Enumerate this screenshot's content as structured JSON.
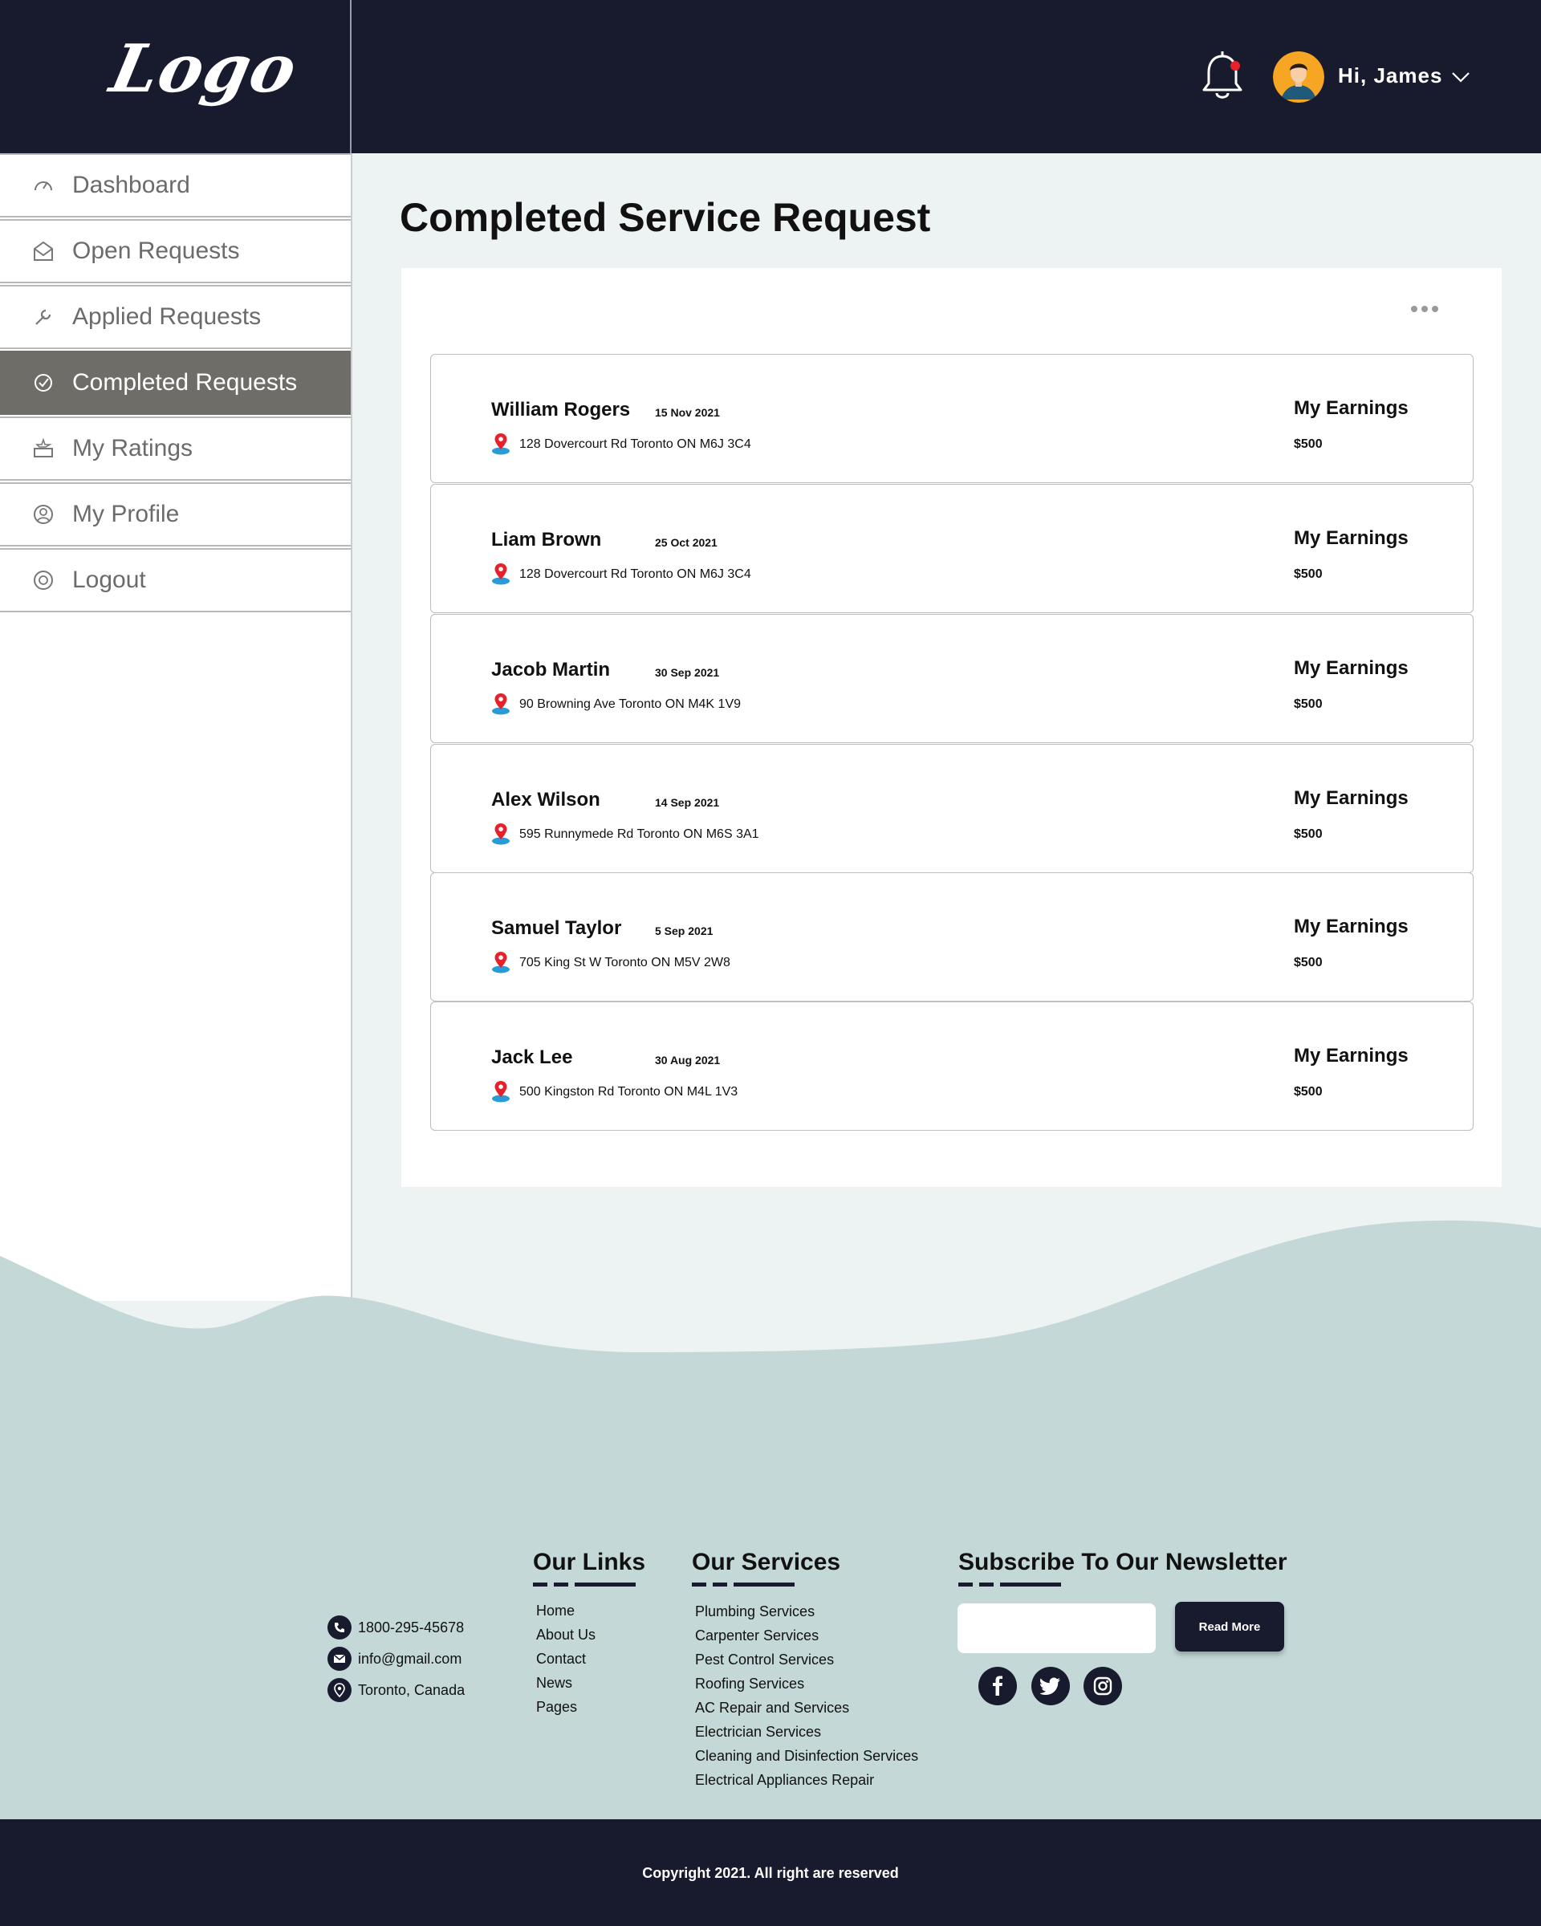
{
  "header": {
    "logo": "Logo",
    "greeting": "Hi, James",
    "notification_dot_color": "#e8202a"
  },
  "sidebar": {
    "items": [
      {
        "label": "Dashboard",
        "icon": "speedometer-icon"
      },
      {
        "label": "Open Requests",
        "icon": "open-envelope-icon"
      },
      {
        "label": "Applied Requests",
        "icon": "wrench-icon"
      },
      {
        "label": "Completed Requests",
        "icon": "check-circle-icon",
        "active": true
      },
      {
        "label": "My Ratings",
        "icon": "ratings-icon"
      },
      {
        "label": "My Profile",
        "icon": "profile-icon"
      },
      {
        "label": "Logout",
        "icon": "logout-icon"
      }
    ]
  },
  "main": {
    "title": "Completed Service Request",
    "requests": [
      {
        "name": "William Rogers",
        "date": "15 Nov 2021",
        "address": "128 Dovercourt Rd Toronto ON M6J 3C4",
        "earnings_label": "My Earnings",
        "earnings": "$500"
      },
      {
        "name": "Liam Brown",
        "date": "25 Oct 2021",
        "address": "128 Dovercourt Rd Toronto ON M6J 3C4",
        "earnings_label": "My Earnings",
        "earnings": "$500"
      },
      {
        "name": "Jacob Martin",
        "date": "30 Sep 2021",
        "address": "90 Browning Ave Toronto ON M4K 1V9",
        "earnings_label": "My Earnings",
        "earnings": "$500"
      },
      {
        "name": "Alex Wilson",
        "date": "14 Sep 2021",
        "address": "595 Runnymede Rd Toronto ON M6S 3A1",
        "earnings_label": "My Earnings",
        "earnings": "$500"
      },
      {
        "name": "Samuel Taylor",
        "date": "5 Sep 2021",
        "address": "705 King St W Toronto ON M5V 2W8",
        "earnings_label": "My Earnings",
        "earnings": "$500"
      },
      {
        "name": "Jack Lee",
        "date": "30 Aug 2021",
        "address": "500 Kingston Rd Toronto ON M4L 1V3",
        "earnings_label": "My Earnings",
        "earnings": "$500"
      }
    ]
  },
  "footer": {
    "contact": {
      "phone": "1800-295-45678",
      "email": "info@gmail.com",
      "location": "Toronto, Canada"
    },
    "links_heading": "Our Links",
    "links": [
      "Home",
      "About Us",
      "Contact",
      "News",
      "Pages"
    ],
    "services_heading": "Our Services",
    "services": [
      "Plumbing Services",
      "Carpenter Services",
      "Pest Control Services",
      "Roofing Services",
      "AC Repair and Services",
      "Electrician Services",
      "Cleaning and Disinfection Services",
      "Electrical Appliances Repair"
    ],
    "newsletter_heading": "Subscribe To Our Newsletter",
    "newsletter_input_value": "",
    "newsletter_button": "Read More",
    "social": [
      "facebook-icon",
      "twitter-icon",
      "instagram-icon"
    ],
    "copyright": "Copyright 2021. All right are reserved"
  },
  "colors": {
    "dark_navy": "#181a2e",
    "sidebar_active": "#6f6d68",
    "wave_teal": "#c3d8d7",
    "page_background": "#edf3f2"
  }
}
